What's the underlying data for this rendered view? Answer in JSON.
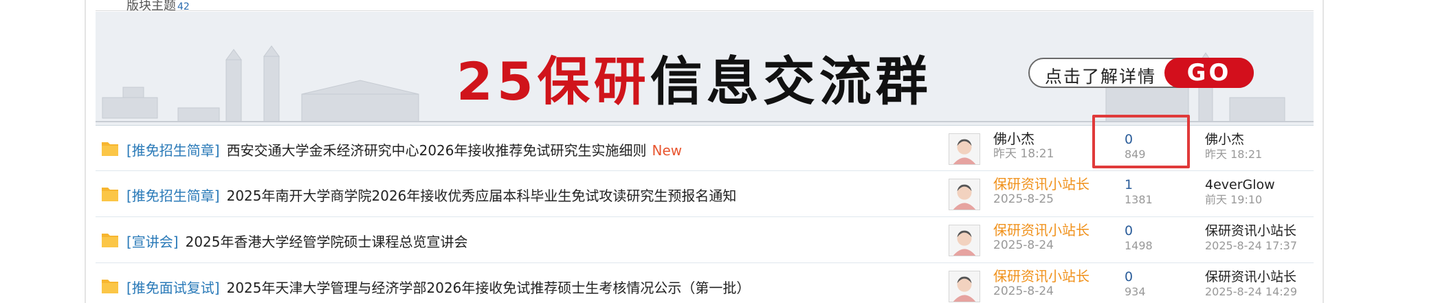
{
  "header": {
    "label": "版块主题",
    "count": "42"
  },
  "banner": {
    "title_red": "25保研",
    "title_black": "信息交流群",
    "cta_text": "点击了解详情",
    "cta_button": "GO"
  },
  "colors": {
    "accent_red": "#d30f1c",
    "link_blue": "#2a7ab8",
    "author_orange": "#f0911b",
    "highlight": "#e03a3a"
  },
  "threads": [
    {
      "category": "[推免招生简章]",
      "title": "西安交通大学金禾经济研究中心2026年接收推荐免试研究生实施细则",
      "badge": "New",
      "author": "佛小杰",
      "author_date": "昨天 18:21",
      "replies": "0",
      "views": "849",
      "last_user": "佛小杰",
      "last_time": "昨天 18:21"
    },
    {
      "category": "[推免招生简章]",
      "title": "2025年南开大学商学院2026年接收优秀应届本科毕业生免试攻读研究生预报名通知",
      "badge": "",
      "author": "保研资讯小站长",
      "author_date": "2025-8-25",
      "replies": "1",
      "views": "1381",
      "last_user": "4everGlow",
      "last_time": "前天 19:10"
    },
    {
      "category": "[宣讲会]",
      "title": "2025年香港大学经管学院硕士课程总览宣讲会",
      "badge": "",
      "author": "保研资讯小站长",
      "author_date": "2025-8-24",
      "replies": "0",
      "views": "1498",
      "last_user": "保研资讯小站长",
      "last_time": "2025-8-24 17:37"
    },
    {
      "category": "[推免面试复试]",
      "title": "2025年天津大学管理与经济学部2026年接收免试推荐硕士生考核情况公示（第一批）",
      "badge": "",
      "author": "保研资讯小站长",
      "author_date": "2025-8-24",
      "replies": "0",
      "views": "934",
      "last_user": "保研资讯小站长",
      "last_time": "2025-8-24 14:29"
    }
  ]
}
